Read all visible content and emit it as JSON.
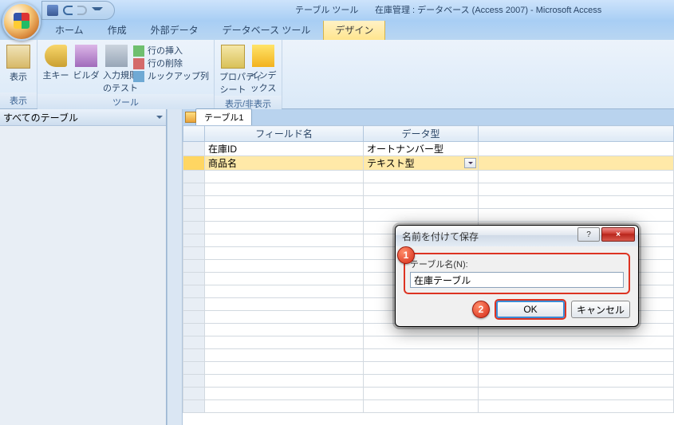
{
  "title_tool": "テーブル ツール",
  "title_db": "在庫管理 : データベース (Access 2007) - Microsoft Access",
  "tabs": {
    "home": "ホーム",
    "create": "作成",
    "external": "外部データ",
    "dbtools": "データベース ツール",
    "design": "デザイン"
  },
  "ribbon": {
    "view": {
      "label": "表示",
      "group": "表示"
    },
    "tools": {
      "pk": "主キー",
      "builder": "ビルダ",
      "test": "入力規則\nのテスト",
      "ins": "行の挿入",
      "del": "行の削除",
      "lookup": "ルックアップ列",
      "group": "ツール"
    },
    "showhide": {
      "prop": "プロパティ\nシート",
      "idx": "インデックス",
      "group": "表示/非表示"
    }
  },
  "nav_header": "すべてのテーブル",
  "design_tab": "テーブル1",
  "cols": {
    "field": "フィールド名",
    "type": "データ型"
  },
  "rows": [
    {
      "field": "在庫ID",
      "type": "オートナンバー型"
    },
    {
      "field": "商品名",
      "type": "テキスト型"
    }
  ],
  "dialog": {
    "title": "名前を付けて保存",
    "label": "テーブル名(N):",
    "value": "在庫テーブル",
    "ok": "OK",
    "cancel": "キャンセル",
    "badge1": "1",
    "badge2": "2"
  }
}
